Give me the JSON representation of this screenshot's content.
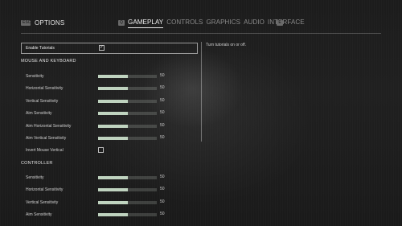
{
  "header": {
    "esc_key": "ESC",
    "title": "OPTIONS",
    "prev_key": "Q",
    "next_key": "E",
    "tabs": [
      {
        "label": "GAMEPLAY",
        "active": true
      },
      {
        "label": "CONTROLS",
        "active": false
      },
      {
        "label": "GRAPHICS",
        "active": false
      },
      {
        "label": "AUDIO",
        "active": false
      },
      {
        "label": "INTERFACE",
        "active": false
      }
    ]
  },
  "settings": {
    "enable_tutorials": {
      "label": "Enable Tutorials",
      "checked": true,
      "check_glyph": "✓"
    },
    "mouse_keyboard": {
      "heading": "MOUSE AND KEYBOARD",
      "sensitivity": {
        "label": "Sensitivity",
        "value": "50",
        "fraction": 0.5
      },
      "horizontal_sensitivity": {
        "label": "Horizontal Sensitivity",
        "value": "50",
        "fraction": 0.5
      },
      "vertical_sensitivity": {
        "label": "Vertical Sensitivity",
        "value": "50",
        "fraction": 0.5
      },
      "aim_sensitivity": {
        "label": "Aim Sensitivity",
        "value": "50",
        "fraction": 0.5
      },
      "aim_horizontal_sensitivity": {
        "label": "Aim Horizontal Sensitivity",
        "value": "50",
        "fraction": 0.5
      },
      "aim_vertical_sensitivity": {
        "label": "Aim Vertical Sensitivity",
        "value": "50",
        "fraction": 0.5
      },
      "invert_mouse_vertical": {
        "label": "Invert Mouse Vertical",
        "checked": false
      }
    },
    "controller": {
      "heading": "CONTROLLER",
      "sensitivity": {
        "label": "Sensitivity",
        "value": "50",
        "fraction": 0.5
      },
      "horizontal_sensitivity": {
        "label": "Horizontal Sensitivity",
        "value": "50",
        "fraction": 0.5
      },
      "vertical_sensitivity": {
        "label": "Vertical Sensitivity",
        "value": "50",
        "fraction": 0.5
      },
      "aim_sensitivity": {
        "label": "Aim Sensitivity",
        "value": "50",
        "fraction": 0.5
      }
    }
  },
  "help": {
    "text": "Turn tutorials on or off."
  },
  "colors": {
    "slider_fill": "#bfd3bf",
    "background": "#1e1e1e",
    "text": "#d6d6d6"
  }
}
